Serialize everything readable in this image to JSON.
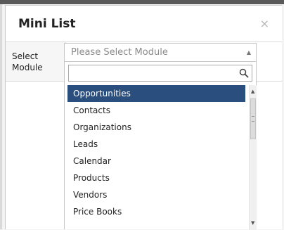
{
  "modal": {
    "title": "Mini List",
    "close_symbol": "×"
  },
  "form": {
    "select_label": "Select\nModule",
    "select_placeholder": "Please Select Module"
  },
  "dropdown": {
    "search_value": "",
    "selected_index": 0,
    "items": [
      "Opportunities",
      "Contacts",
      "Organizations",
      "Leads",
      "Calendar",
      "Products",
      "Vendors",
      "Price Books"
    ]
  },
  "icons": {
    "close": "close-icon",
    "search": "search-icon",
    "select_arrow": "chevron-up-icon",
    "scroll_up": "scroll-up-icon",
    "scroll_down": "scroll-down-icon"
  },
  "colors": {
    "selected_bg": "#2a4f7e",
    "selected_text": "#ffffff"
  }
}
